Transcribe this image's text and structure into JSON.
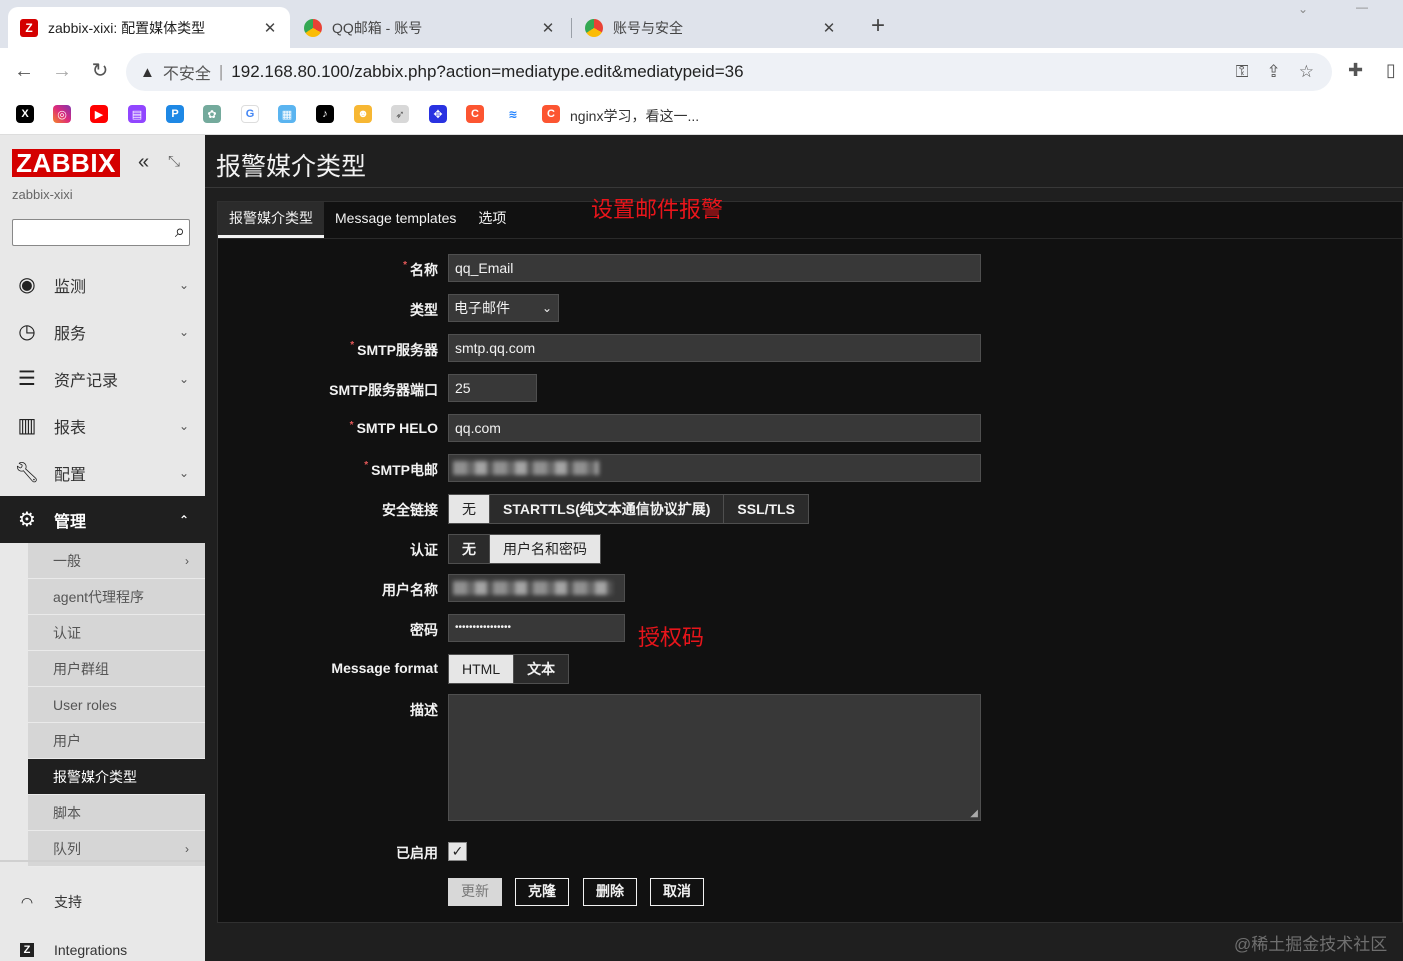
{
  "browser": {
    "tabs": [
      {
        "label": "zabbix-xixi: 配置媒体类型",
        "icon": "zabbix-favicon-icon",
        "active": true
      },
      {
        "label": "QQ邮箱 - 账号",
        "icon": "chrome-favicon-icon",
        "active": false
      },
      {
        "label": "账号与安全",
        "icon": "chrome-favicon-icon",
        "active": false
      }
    ],
    "new_tab": "+",
    "insecure_label": "不安全",
    "url": "192.168.80.100/zabbix.php?action=mediatype.edit&mediatypeid=36",
    "bookmark_text": "nginx学习，看这一..."
  },
  "sidebar": {
    "logo": "ZABBIX",
    "server_name": "zabbix-xixi",
    "search_placeholder": "",
    "menu": [
      {
        "label": "监测",
        "icon": "eye-icon"
      },
      {
        "label": "服务",
        "icon": "clock-icon"
      },
      {
        "label": "资产记录",
        "icon": "list-icon"
      },
      {
        "label": "报表",
        "icon": "bar-chart-icon"
      },
      {
        "label": "配置",
        "icon": "wrench-icon"
      },
      {
        "label": "管理",
        "icon": "gear-icon"
      }
    ],
    "submenu": [
      {
        "label": "一般",
        "arrow": true
      },
      {
        "label": "agent代理程序",
        "arrow": false
      },
      {
        "label": "认证",
        "arrow": false
      },
      {
        "label": "用户群组",
        "arrow": false
      },
      {
        "label": "User roles",
        "arrow": false
      },
      {
        "label": "用户",
        "arrow": false
      },
      {
        "label": "报警媒介类型",
        "arrow": false
      },
      {
        "label": "脚本",
        "arrow": false
      },
      {
        "label": "队列",
        "arrow": true
      }
    ],
    "bottom": [
      {
        "label": "支持",
        "icon": "headset-icon"
      },
      {
        "label": "Integrations",
        "icon": "zabbix-z-icon"
      }
    ]
  },
  "main": {
    "page_title": "报警媒介类型",
    "tabs": [
      "报警媒介类型",
      "Message templates",
      "选项"
    ],
    "annotation_top": "设置邮件报警",
    "annotation_password": "授权码",
    "form": {
      "name_label": "名称",
      "name_value": "qq_Email",
      "type_label": "类型",
      "type_value": "电子邮件",
      "smtp_server_label": "SMTP服务器",
      "smtp_server_value": "smtp.qq.com",
      "smtp_port_label": "SMTP服务器端口",
      "smtp_port_value": "25",
      "smtp_helo_label": "SMTP HELO",
      "smtp_helo_value": "qq.com",
      "smtp_email_label": "SMTP电邮",
      "security_label": "安全链接",
      "security_options": [
        "无",
        "STARTTLS(纯文本通信协议扩展)",
        "SSL/TLS"
      ],
      "auth_label": "认证",
      "auth_options": [
        "无",
        "用户名和密码"
      ],
      "username_label": "用户名称",
      "password_label": "密码",
      "password_value": "••••••••••••••••",
      "message_format_label": "Message format",
      "message_format_options": [
        "HTML",
        "文本"
      ],
      "description_label": "描述",
      "enabled_label": "已启用",
      "buttons": [
        "更新",
        "克隆",
        "删除",
        "取消"
      ]
    }
  },
  "watermark": "@稀土掘金技术社区"
}
